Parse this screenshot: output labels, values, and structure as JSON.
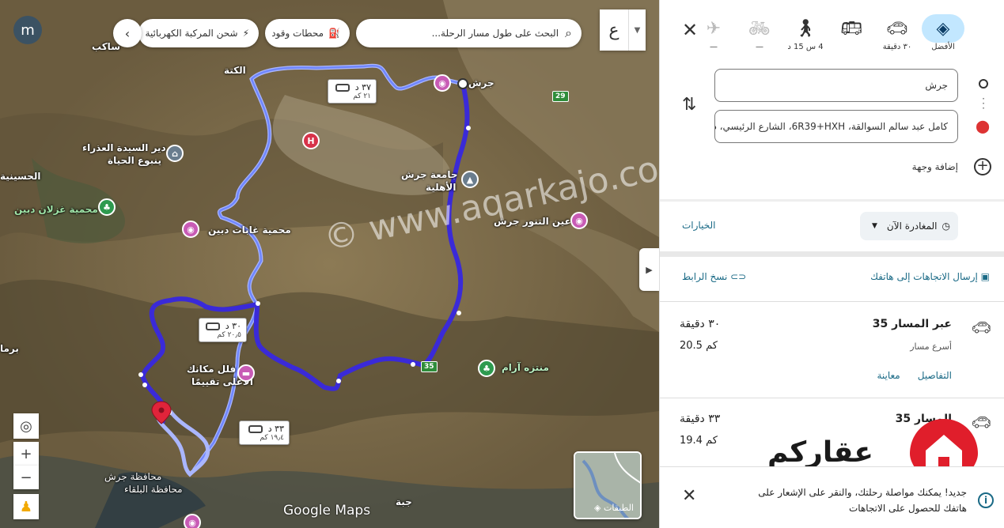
{
  "map": {
    "search_placeholder": "البحث على طول مسار الرحلة...",
    "chip_fuel": "محطات وقود",
    "chip_ev": "شحن المركبة الكهربائية",
    "lang_glyph": "ع",
    "avatar_letter": "m",
    "layers_label": "الطبقات",
    "google_text": "Google Maps",
    "watermark": "© www.aqarkajo.com",
    "labels": {
      "jerash": "جرش",
      "kitta": "الكتة",
      "deir": "دير السيدة العذراء",
      "deir2": "ينبوع الحياة",
      "ghazlan": "محمية غزلان دبين",
      "dibeen": "محمية غابات دبين",
      "jadara": "جامعة جرش",
      "jadara2": "الأهلية",
      "ayn": "عين التنور جرش",
      "villa": "فلل مكانك",
      "villa2": "الأعلى تقييمًا",
      "aram": "منتزه آرام",
      "gov_jerash": "محافظة جرش",
      "gov_balqa": "محافظة البلقاء",
      "jubeiha": "جبة",
      "sakib": "ساكب",
      "husseini": "الحسينية",
      "burma": "برما"
    },
    "route_boxes": [
      {
        "time": "٣٧ د",
        "dist": "٢١ كم"
      },
      {
        "time": "٣٠ د",
        "dist": "٢٠٫٥ كم"
      },
      {
        "time": "٣٣ د",
        "dist": "١٩٫٤ كم"
      }
    ],
    "road_badges": [
      "29",
      "35"
    ]
  },
  "panel": {
    "modes": [
      {
        "label": "الأفضل",
        "icon": "directions-icon"
      },
      {
        "label": "٣٠ دقيقة",
        "icon": "car-icon"
      },
      {
        "label": "",
        "icon": "bus-icon"
      },
      {
        "label": "4 س 15 د",
        "icon": "walk-icon"
      },
      {
        "label": "—",
        "icon": "bike-icon"
      },
      {
        "label": "—",
        "icon": "plane-icon"
      }
    ],
    "from_value": "جرش",
    "to_value": "كامل عبد سالم السوالقة، 6R39+HXH، الشارع الرئيسي، دبين",
    "add_destination": "إضافة وجهة",
    "depart_now": "المغادرة الآن",
    "options": "الخيارات",
    "send_to_phone": "إرسال الاتجاهات إلى هاتفك",
    "copy_link": "نسخ الرابط",
    "routes": [
      {
        "name": "عبر المسار 35",
        "time": "٣٠ دقيقة",
        "sub": "أسرع مسار",
        "dist": "20.5 كم",
        "details": "التفاصيل",
        "preview": "معاينة"
      },
      {
        "name": "المسار 35",
        "time": "٣٣ دقيقة",
        "sub": "",
        "dist": "19.4 كم"
      }
    ],
    "brand_word": "عقاركم",
    "notice": "جديد! يمكنك مواصلة رحلتك، والنقر على الإشعار على هاتفك للحصول على الاتجاهات"
  }
}
